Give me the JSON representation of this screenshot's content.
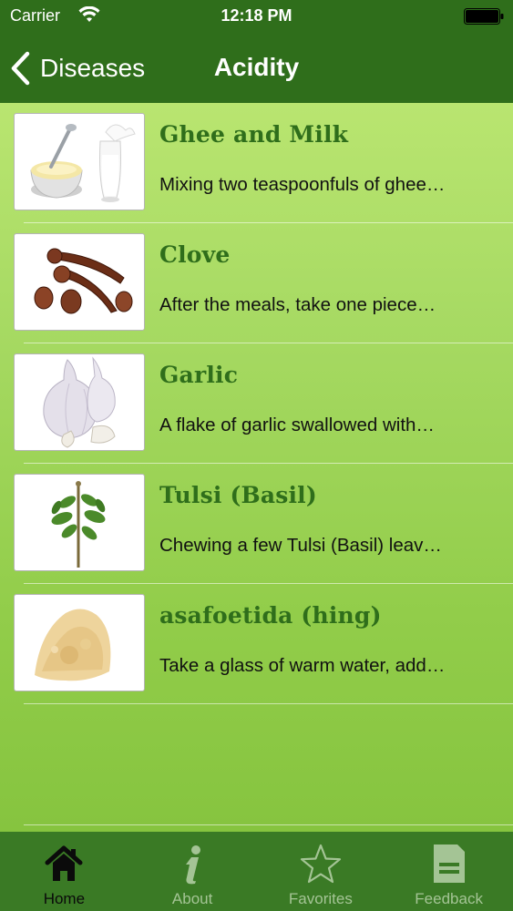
{
  "status_bar": {
    "carrier": "Carrier",
    "time": "12:18 PM"
  },
  "nav": {
    "back_label": "Diseases",
    "title": "Acidity"
  },
  "remedies": [
    {
      "title": "Ghee and Milk",
      "description": "Mixing two teaspoonfuls of ghee…",
      "image": "ghee-milk-image"
    },
    {
      "title": "Clove",
      "description": "After the meals, take one piece…",
      "image": "clove-image"
    },
    {
      "title": "Garlic",
      "description": "A flake of garlic swallowed with…",
      "image": "garlic-image"
    },
    {
      "title": "Tulsi (Basil)",
      "description": "Chewing a few Tulsi (Basil) leav…",
      "image": "tulsi-image"
    },
    {
      "title": "asafoetida (hing)",
      "description": "Take a glass of warm water, add…",
      "image": "asafoetida-image"
    }
  ],
  "tabs": [
    {
      "label": "Home",
      "icon": "home-icon",
      "active": true
    },
    {
      "label": "About",
      "icon": "info-icon",
      "active": false
    },
    {
      "label": "Favorites",
      "icon": "star-icon",
      "active": false
    },
    {
      "label": "Feedback",
      "icon": "document-icon",
      "active": false
    }
  ],
  "colors": {
    "header": "#2f6e1b",
    "title_green": "#2f6e1b",
    "tab_bar": "#3a7a25"
  }
}
